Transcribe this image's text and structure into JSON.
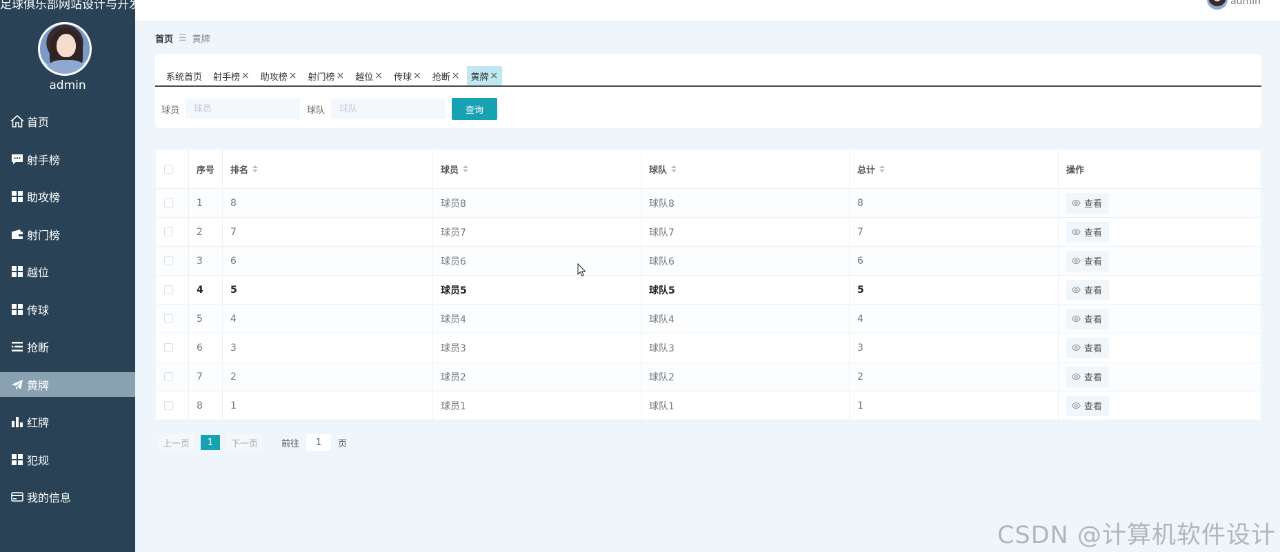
{
  "sidebar": {
    "site_title": "足球俱乐部网站设计与开发",
    "user_name": "admin",
    "items": [
      {
        "label": "首页",
        "icon": "home-icon"
      },
      {
        "label": "射手榜",
        "icon": "message-icon"
      },
      {
        "label": "助攻榜",
        "icon": "grid-icon"
      },
      {
        "label": "射门榜",
        "icon": "wallet-icon"
      },
      {
        "label": "越位",
        "icon": "grid-icon"
      },
      {
        "label": "传球",
        "icon": "grid-icon"
      },
      {
        "label": "抢断",
        "icon": "list-icon"
      },
      {
        "label": "黄牌",
        "icon": "send-icon"
      },
      {
        "label": "红牌",
        "icon": "bar-chart-icon"
      },
      {
        "label": "犯规",
        "icon": "grid-icon"
      },
      {
        "label": "我的信息",
        "icon": "card-icon"
      }
    ],
    "active_index": 7
  },
  "header": {
    "user_name": "admin"
  },
  "breadcrumb": {
    "home": "首页",
    "separator": "☰",
    "current": "黄牌"
  },
  "tabs": [
    {
      "label": "系统首页",
      "closable": false
    },
    {
      "label": "射手榜",
      "closable": true
    },
    {
      "label": "助攻榜",
      "closable": true
    },
    {
      "label": "射门榜",
      "closable": true
    },
    {
      "label": "越位",
      "closable": true
    },
    {
      "label": "传球",
      "closable": true
    },
    {
      "label": "抢断",
      "closable": true
    },
    {
      "label": "黄牌",
      "closable": true
    }
  ],
  "active_tab": 7,
  "search": {
    "player_label": "球员",
    "player_placeholder": "球员",
    "team_label": "球队",
    "team_placeholder": "球队",
    "button": "查询"
  },
  "table": {
    "headers": {
      "index": "序号",
      "rank": "排名",
      "player": "球员",
      "team": "球队",
      "total": "总计",
      "ops": "操作"
    },
    "view_label": "查看",
    "rows": [
      {
        "index": "1",
        "rank": "8",
        "player": "球员8",
        "team": "球队8",
        "total": "8"
      },
      {
        "index": "2",
        "rank": "7",
        "player": "球员7",
        "team": "球队7",
        "total": "7"
      },
      {
        "index": "3",
        "rank": "6",
        "player": "球员6",
        "team": "球队6",
        "total": "6"
      },
      {
        "index": "4",
        "rank": "5",
        "player": "球员5",
        "team": "球队5",
        "total": "5"
      },
      {
        "index": "5",
        "rank": "4",
        "player": "球员4",
        "team": "球队4",
        "total": "4"
      },
      {
        "index": "6",
        "rank": "3",
        "player": "球员3",
        "team": "球队3",
        "total": "3"
      },
      {
        "index": "7",
        "rank": "2",
        "player": "球员2",
        "team": "球队2",
        "total": "2"
      },
      {
        "index": "8",
        "rank": "1",
        "player": "球员1",
        "team": "球队1",
        "total": "1"
      }
    ],
    "highlight_row": 3
  },
  "pagination": {
    "prev": "上一页",
    "current_page": "1",
    "next": "下一页",
    "goto": "前往",
    "goto_value": "1",
    "unit": "页"
  },
  "watermark": "CSDN @计算机软件设计",
  "colors": {
    "sidebar_bg": "#294255",
    "active_item": "#8aa1b1",
    "accent": "#16a2b3",
    "active_tab": "#bfe8f2",
    "page_bg": "#eef5fb"
  }
}
